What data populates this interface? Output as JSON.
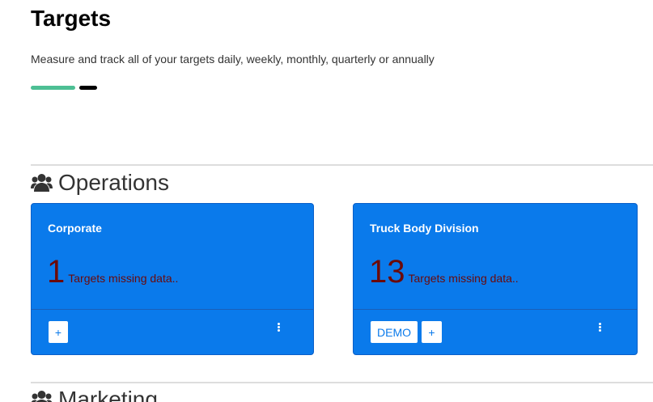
{
  "page": {
    "title": "Targets",
    "subtitle": "Measure and track all of your targets daily, weekly, monthly, quarterly or annually"
  },
  "colors": {
    "accent_green": "#4dbf94",
    "accent_black": "#000000",
    "card_background": "#0a7aeb",
    "metric_red": "#6b0a0a",
    "button_text": "#0a7aeb"
  },
  "sections": [
    {
      "icon": "users-icon",
      "title": "Operations",
      "cards": [
        {
          "title": "Corporate",
          "count": "1",
          "label": "Targets missing data..",
          "buttons": [
            "+"
          ],
          "menu_icon": "kebab-menu-icon"
        },
        {
          "title": "Truck Body Division",
          "count": "13",
          "label": "Targets missing data..",
          "buttons": [
            "DEMO",
            "+"
          ],
          "menu_icon": "kebab-menu-icon"
        }
      ]
    },
    {
      "icon": "users-icon",
      "title": "Marketing",
      "cards": []
    }
  ]
}
